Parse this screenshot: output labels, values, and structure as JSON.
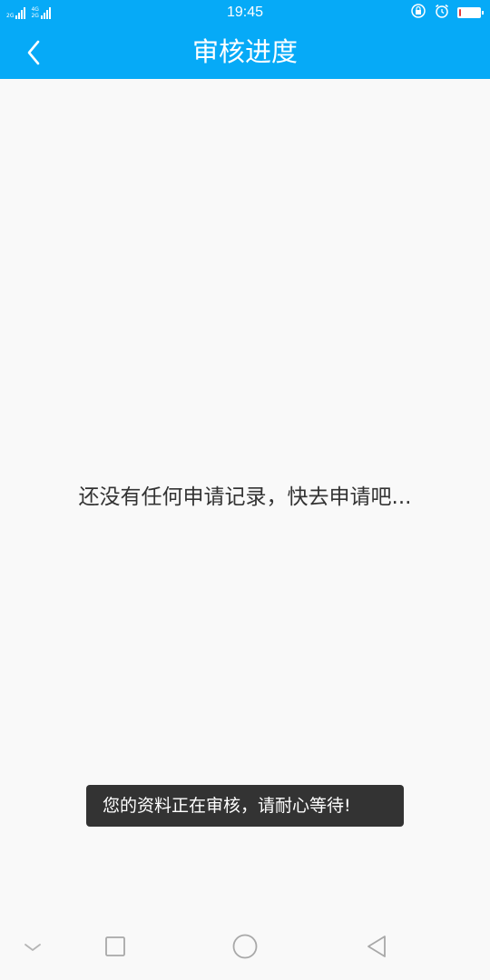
{
  "status_bar": {
    "time": "19:45",
    "sim1_network": "2G",
    "sim2_network_top": "4G",
    "sim2_network_bottom": "2G",
    "battery_level": 0.1,
    "icons": [
      "signal-icon",
      "lock-rotation-icon",
      "alarm-clock-icon",
      "battery-icon"
    ]
  },
  "header": {
    "title": "审核进度",
    "back_icon": "chevron-left-icon"
  },
  "main": {
    "empty_message": "还没有任何申请记录，快去申请吧..."
  },
  "toast": {
    "message": "您的资料正在审核，请耐心等待!"
  },
  "nav_bar": {
    "icons": [
      "chevron-down-icon",
      "square-icon",
      "circle-icon",
      "triangle-back-icon"
    ]
  },
  "colors": {
    "accent": "#06aaf7",
    "background": "#f9f9f9",
    "text": "#333333",
    "toast_bg": "#333333",
    "battery_low": "#e53935"
  }
}
